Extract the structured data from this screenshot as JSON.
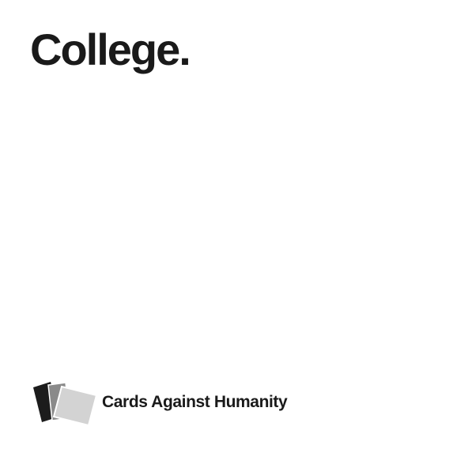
{
  "card": {
    "text": "College."
  },
  "brand": {
    "name": "Cards Against Humanity",
    "logo_icon": "stacked-cards-icon",
    "logo_colors": [
      "#1c1c1c",
      "#8a8a8a",
      "#d3d3d3"
    ]
  },
  "colors": {
    "background": "#ffffff",
    "text": "#1a1a1a"
  }
}
